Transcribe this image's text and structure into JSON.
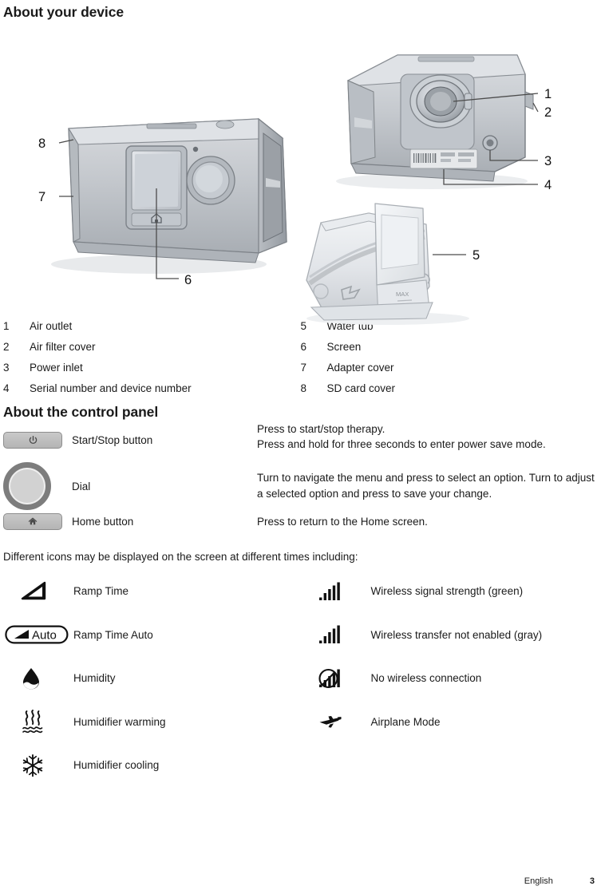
{
  "document": {
    "heading_device": "About your device",
    "heading_control_panel": "About the control panel",
    "icons_intro": "Different icons may be displayed on the screen at different times including:"
  },
  "figures": {
    "front_view": {
      "name": "device-front-view",
      "callouts": [
        "8",
        "7",
        "6"
      ]
    },
    "rear_view": {
      "name": "device-rear-view",
      "callouts": [
        "1",
        "2",
        "3",
        "4"
      ]
    },
    "water_tub": {
      "name": "water-tub-view",
      "callouts": [
        "5"
      ],
      "marking": "MAX"
    }
  },
  "parts": {
    "left": [
      {
        "num": "1",
        "label": "Air outlet"
      },
      {
        "num": "2",
        "label": "Air filter cover"
      },
      {
        "num": "3",
        "label": "Power inlet"
      },
      {
        "num": "4",
        "label": "Serial number and device number"
      }
    ],
    "right": [
      {
        "num": "5",
        "label": "Water tub"
      },
      {
        "num": "6",
        "label": "Screen"
      },
      {
        "num": "7",
        "label": "Adapter cover"
      },
      {
        "num": "8",
        "label": "SD card cover"
      }
    ]
  },
  "control_panel": {
    "rows": [
      {
        "icon": "power-icon",
        "name": "Start/Stop button",
        "description": "Press to start/stop therapy.\nPress and hold for three seconds to enter power save mode."
      },
      {
        "icon": "dial-icon",
        "name": "Dial",
        "description": "Turn to navigate the menu and press to select an option. Turn to adjust a selected option and press to save your change."
      },
      {
        "icon": "home-icon",
        "name": "Home button",
        "description": "Press to return to the Home screen."
      }
    ]
  },
  "screen_icons": {
    "left": [
      {
        "icon": "ramp-time-icon",
        "label": "Ramp Time"
      },
      {
        "icon": "ramp-time-auto-icon",
        "label": "Ramp Time Auto",
        "badge_text": "Auto"
      },
      {
        "icon": "humidity-icon",
        "label": "Humidity"
      },
      {
        "icon": "humidifier-warming-icon",
        "label": "Humidifier warming"
      },
      {
        "icon": "humidifier-cooling-icon",
        "label": "Humidifier cooling"
      }
    ],
    "right": [
      {
        "icon": "wireless-signal-strength-icon",
        "label": "Wireless signal strength (green)"
      },
      {
        "icon": "wireless-not-enabled-icon",
        "label": "Wireless transfer not enabled (gray)"
      },
      {
        "icon": "no-wireless-connection-icon",
        "label": "No wireless connection"
      },
      {
        "icon": "airplane-mode-icon",
        "label": "Airplane Mode"
      }
    ]
  },
  "footer": {
    "language": "English",
    "page_number": "3"
  },
  "colors": {
    "text": "#1a1a1a",
    "device_body": "#c3c6c9",
    "device_outline": "#6f7378",
    "button_face": "#c0c0c0"
  }
}
